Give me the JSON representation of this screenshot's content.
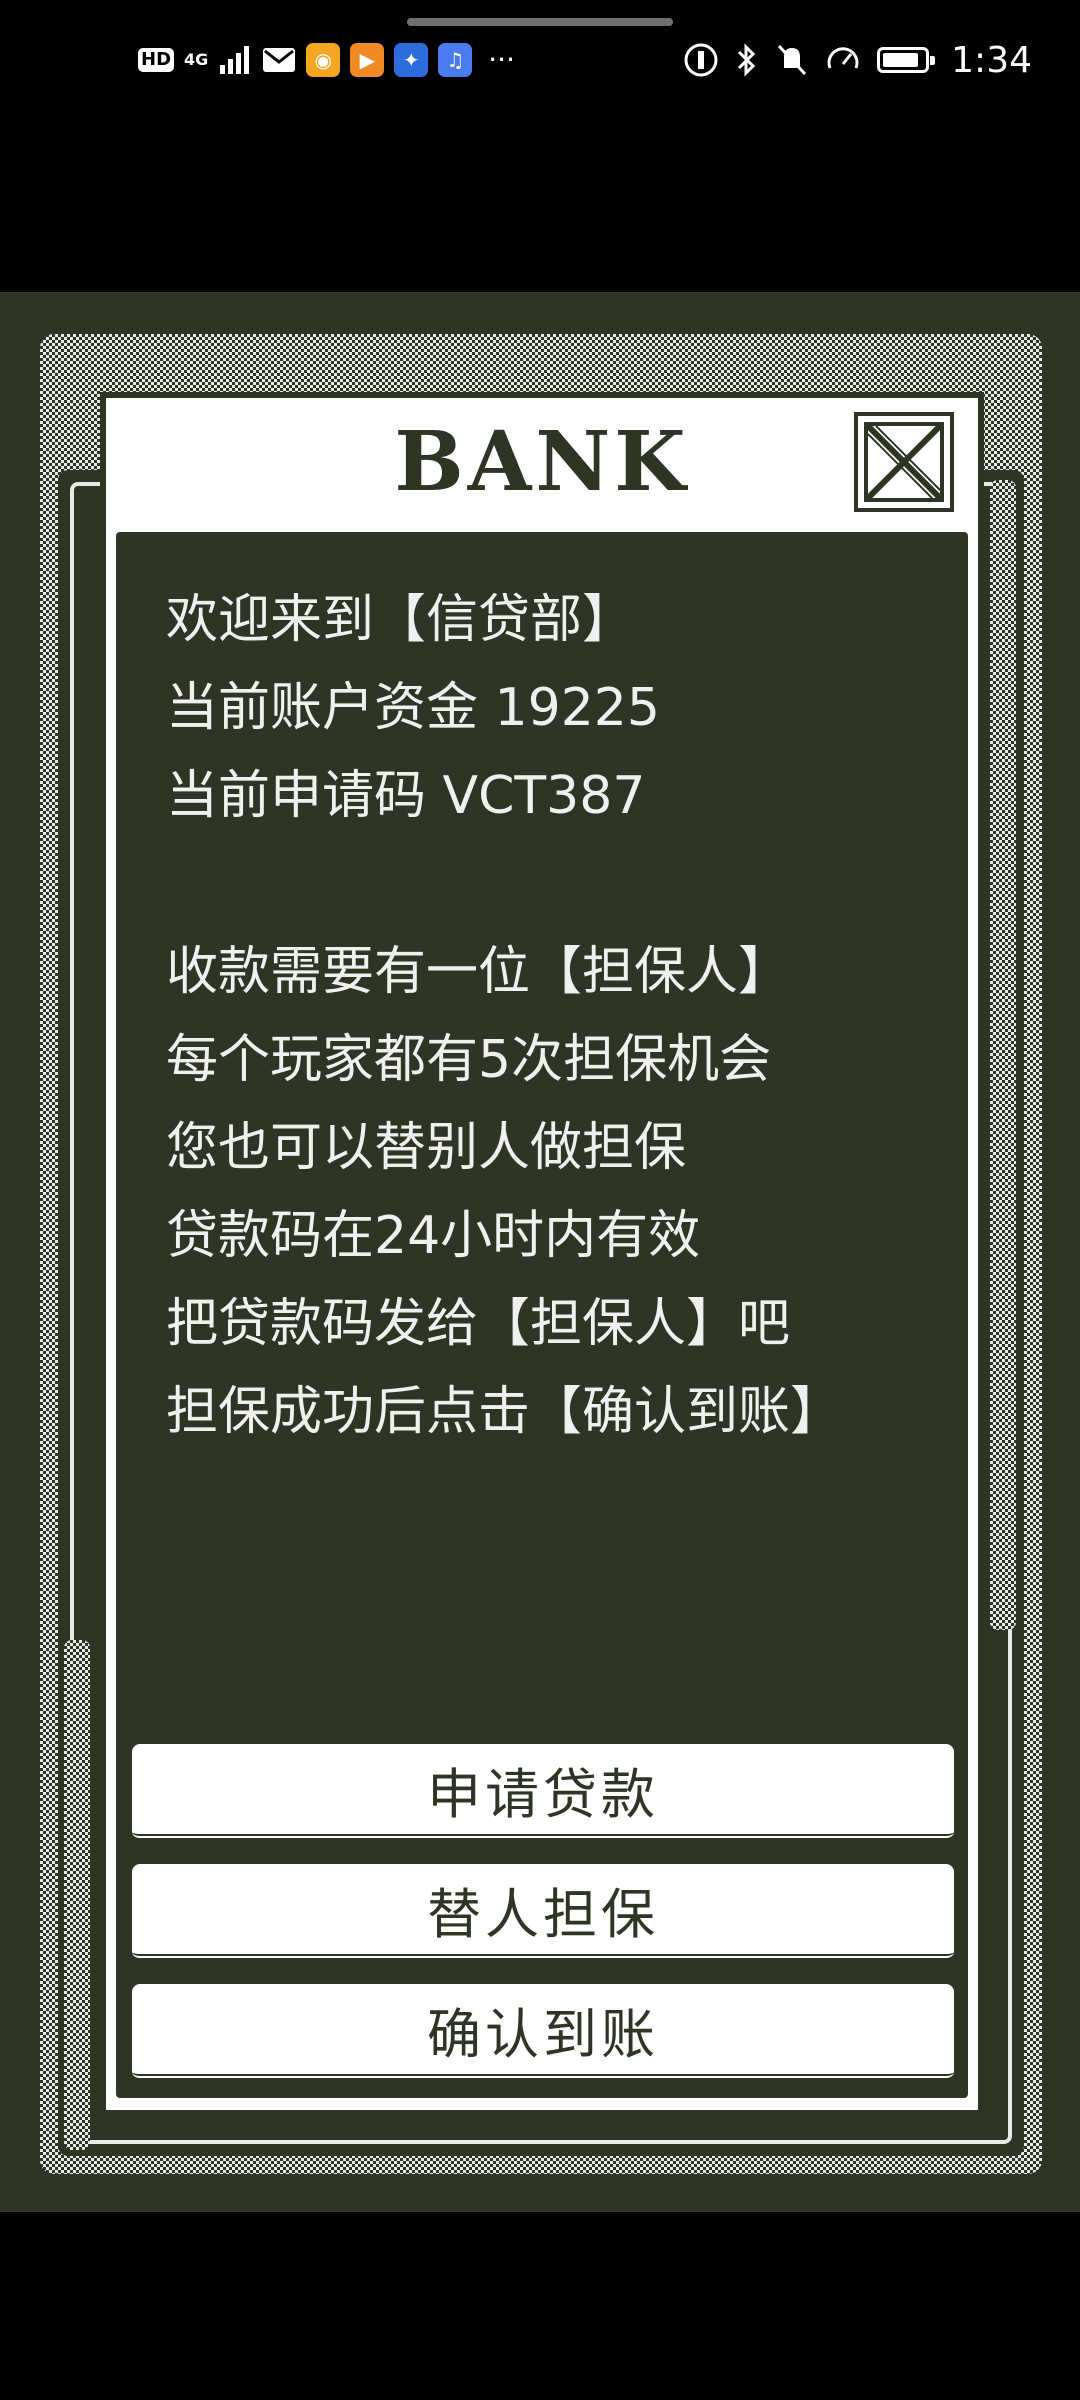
{
  "status_bar": {
    "hd_label": "HD",
    "network_label": "4G",
    "time": "1:34",
    "left_icons": [
      "signal-icon",
      "mail-icon",
      "weibo-icon",
      "video-app-icon",
      "bulb-app-icon",
      "music-app-icon"
    ],
    "more_label": "···",
    "right_icons": [
      "data-saver-icon",
      "bluetooth-icon",
      "mute-icon",
      "speed-icon",
      "battery-icon"
    ],
    "battery_level": 0.9
  },
  "dialog": {
    "title": "BANK",
    "message_lines": [
      "欢迎来到【信贷部】",
      "当前账户资金 19225",
      "当前申请码 VCT387",
      "",
      "收款需要有一位【担保人】",
      "每个玩家都有5次担保机会",
      "您也可以替别人做担保",
      "贷款码在24小时内有效",
      "把贷款码发给【担保人】吧",
      "担保成功后点击【确认到账】"
    ],
    "buttons": {
      "apply_loan": "申请贷款",
      "guarantee_for_others": "替人担保",
      "confirm_receipt": "确认到账"
    }
  },
  "colors": {
    "panel": "#2e3524",
    "light": "#ffffff",
    "text_light": "#f0f0f0"
  }
}
